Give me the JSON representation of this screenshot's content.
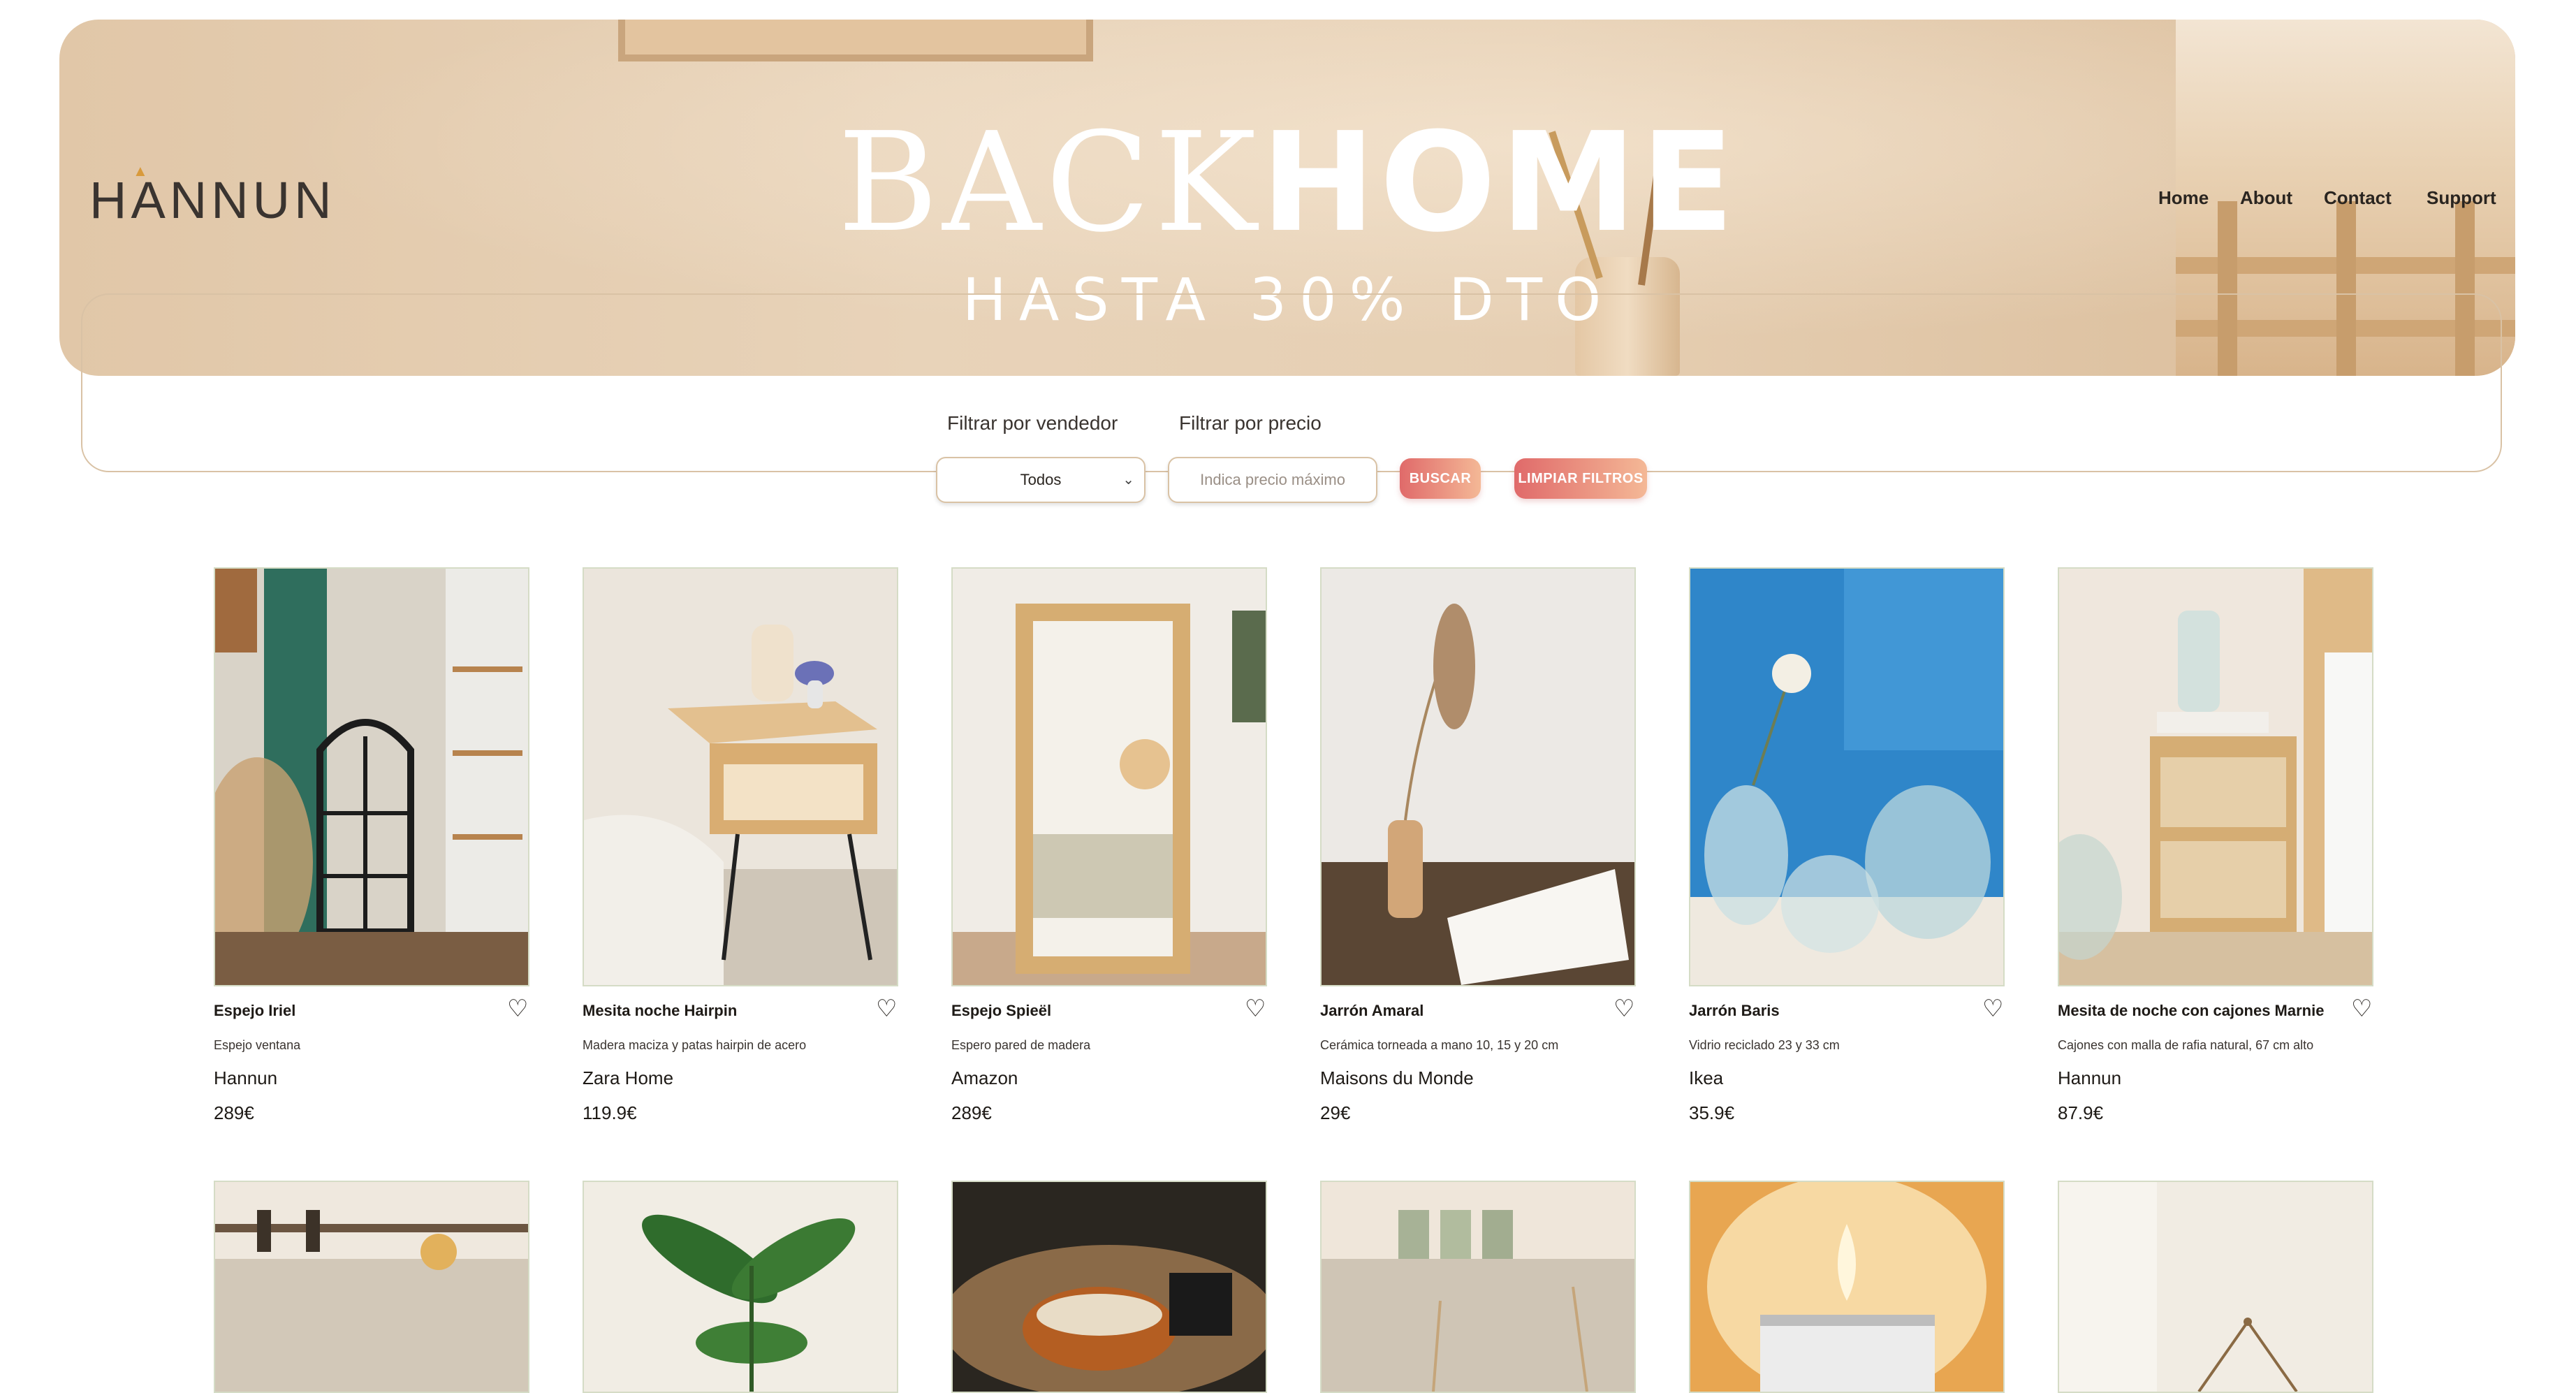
{
  "brand": {
    "logo": "HANNUN"
  },
  "hero": {
    "title_light": "BACK",
    "title_bold": "HOME",
    "subtitle": "HASTA 30% DTO"
  },
  "nav": {
    "items": [
      "Home",
      "About",
      "Contact",
      "Support"
    ]
  },
  "filters": {
    "vendor_label": "Filtrar por vendedor",
    "price_label": "Filtrar por precio",
    "vendor_selected": "Todos",
    "price_placeholder": "Indica precio máximo",
    "search_button": "BUSCAR",
    "clear_button": "LIMPIAR FILTROS"
  },
  "products": [
    {
      "name": "Espejo Iriel",
      "desc": "Espejo ventana",
      "seller": "Hannun",
      "price": "289€"
    },
    {
      "name": "Mesita noche Hairpin",
      "desc": "Madera maciza y patas hairpin de acero",
      "seller": "Zara Home",
      "price": "119.9€"
    },
    {
      "name": "Espejo Spieël",
      "desc": "Espero pared de madera",
      "seller": "Amazon",
      "price": "289€"
    },
    {
      "name": "Jarrón Amaral",
      "desc": "Cerámica torneada a mano 10, 15 y 20 cm",
      "seller": "Maisons du Monde",
      "price": "29€"
    },
    {
      "name": "Jarrón Baris",
      "desc": "Vidrio reciclado 23 y 33 cm",
      "seller": "Ikea",
      "price": "35.9€"
    },
    {
      "name": "Mesita de noche con cajones Marnie",
      "desc": "Cajones con malla de rafia natural, 67 cm alto",
      "seller": "Hannun",
      "price": "87.9€"
    }
  ],
  "colors": {
    "accent_start": "#e06a6a",
    "accent_end": "#f4b896",
    "card_border": "#d5dcc6",
    "filter_border": "#d9c2a5"
  }
}
